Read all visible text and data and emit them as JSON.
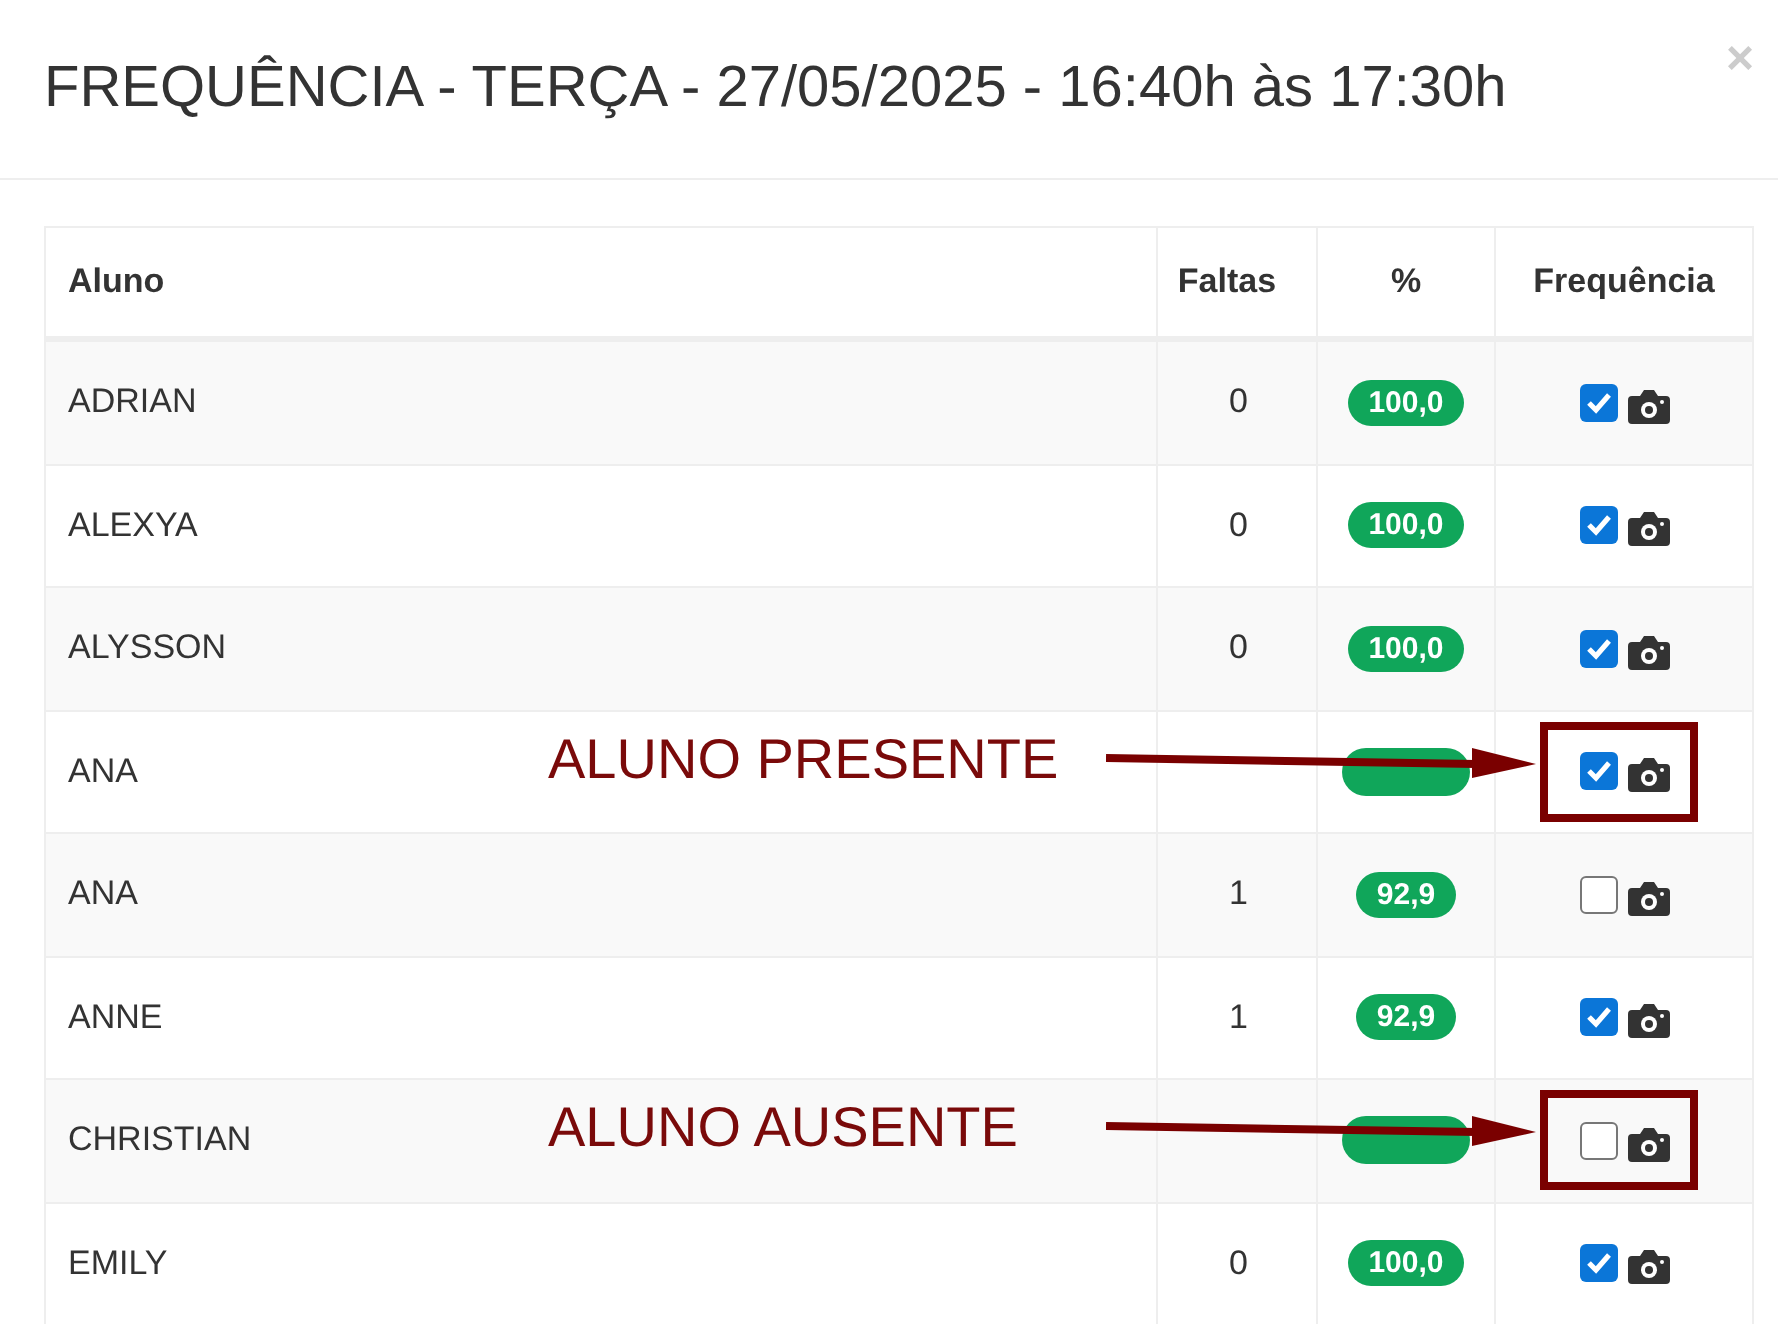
{
  "modal": {
    "title": "FREQUÊNCIA - TERÇA - 27/05/2025 - 16:40h às 17:30h",
    "close": "×"
  },
  "table": {
    "columns": [
      "Aluno",
      "Faltas",
      "%",
      "Frequência"
    ],
    "rows": [
      {
        "name": "ADRIAN",
        "absences": "0",
        "percent": "100,0",
        "present": true
      },
      {
        "name": "ALEXYA",
        "absences": "0",
        "percent": "100,0",
        "present": true
      },
      {
        "name": "ALYSSON",
        "absences": "0",
        "percent": "100,0",
        "present": true
      },
      {
        "name": "ANA",
        "present": true,
        "annotation": "ALUNO PRESENTE"
      },
      {
        "name": "ANA",
        "absences": "1",
        "percent": "92,9",
        "present": false
      },
      {
        "name": "ANNE",
        "absences": "1",
        "percent": "92,9",
        "present": true
      },
      {
        "name": "CHRISTIAN",
        "present": false,
        "annotation": "ALUNO AUSENTE"
      },
      {
        "name": "EMILY",
        "absences": "0",
        "percent": "100,0",
        "present": true
      }
    ]
  }
}
